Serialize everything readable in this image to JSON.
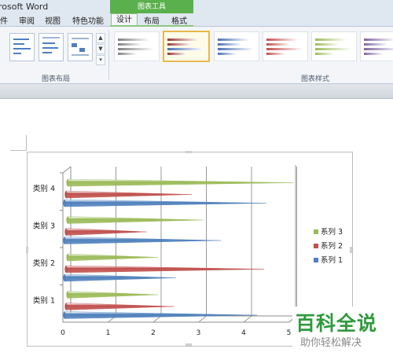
{
  "app": {
    "title": "rosoft Word"
  },
  "ribbon": {
    "context_group": "图表工具",
    "tabs": [
      {
        "label": "件"
      },
      {
        "label": "审阅"
      },
      {
        "label": "视图"
      },
      {
        "label": "特色功能"
      },
      {
        "label": "设计",
        "active": true
      },
      {
        "label": "布局"
      },
      {
        "label": "格式"
      }
    ],
    "groups": {
      "layout": "图表布局",
      "styles": "图表样式"
    },
    "style_colors": [
      "#7f7f7f",
      "#9b3634",
      "#4a72b5",
      "#c0504d",
      "#9bbb59",
      "#8064a2"
    ],
    "selected_style_index": 1
  },
  "chart_data": {
    "type": "bar",
    "orientation": "horizontal",
    "style": "3d-cone",
    "categories": [
      "类别 1",
      "类别 2",
      "类别 3",
      "类别 4"
    ],
    "series": [
      {
        "name": "系列 1",
        "color": "#4f81bd",
        "values": [
          4.3,
          2.5,
          3.5,
          4.5
        ]
      },
      {
        "name": "系列 2",
        "color": "#c0504d",
        "values": [
          2.4,
          4.4,
          1.8,
          2.8
        ]
      },
      {
        "name": "系列 3",
        "color": "#9bbb59",
        "values": [
          2,
          2,
          3,
          5
        ]
      }
    ],
    "xlim": [
      0,
      5
    ],
    "xticks": [
      "0",
      "1",
      "2",
      "3",
      "4",
      "5"
    ],
    "grid": true,
    "legend_position": "right"
  },
  "watermark": {
    "main": "百科全说",
    "sub": "助你轻松解决"
  }
}
